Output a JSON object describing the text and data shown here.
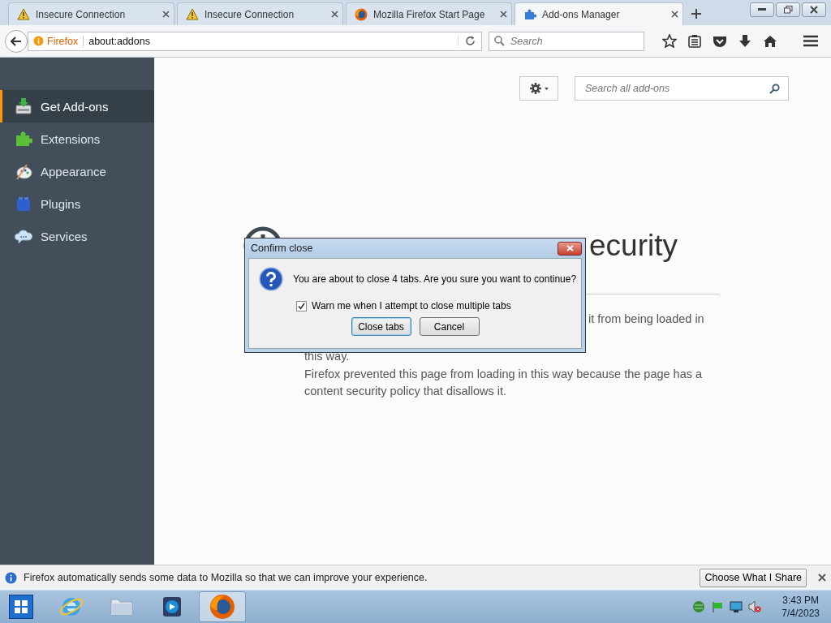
{
  "tabs": [
    {
      "label": "Insecure Connection",
      "kind": "warning",
      "selected": false
    },
    {
      "label": "Insecure Connection",
      "kind": "warning",
      "selected": false
    },
    {
      "label": "Mozilla Firefox Start Page",
      "kind": "firefox",
      "selected": false
    },
    {
      "label": "Add-ons Manager",
      "kind": "puzzle",
      "selected": true
    }
  ],
  "nav": {
    "identity": "Firefox",
    "url": "about:addons",
    "search": {
      "placeholder": "Search"
    }
  },
  "sidebar": {
    "items": [
      {
        "label": "Get Add-ons",
        "kind": "download",
        "selected": true
      },
      {
        "label": "Extensions",
        "kind": "puzzle",
        "selected": false
      },
      {
        "label": "Appearance",
        "kind": "palette",
        "selected": false
      },
      {
        "label": "Plugins",
        "kind": "brick",
        "selected": false
      },
      {
        "label": "Services",
        "kind": "cloud",
        "selected": false
      }
    ]
  },
  "toolbar": {
    "search": {
      "placeholder": "Search all add-ons"
    }
  },
  "page": {
    "heading": "ecurity",
    "fragments": [
      "it from being loaded in",
      "this way."
    ],
    "paragraph": "Firefox prevented this page from loading in this way because the page has a content security policy that disallows it."
  },
  "dialog": {
    "title": "Confirm close",
    "message": "You are about to close 4 tabs. Are you sure you want to continue?",
    "checkbox": {
      "label": "Warn me when I attempt to close multiple tabs",
      "checked": true
    },
    "buttons": [
      {
        "label": "Close tabs",
        "default": true
      },
      {
        "label": "Cancel",
        "default": false
      }
    ]
  },
  "notification": {
    "message": "Firefox automatically sends some data to Mozilla so that we can improve your experience.",
    "button": "Choose What I Share"
  },
  "taskbar": {
    "apps": [
      {
        "kind": "browser",
        "selected": false
      },
      {
        "kind": "folder",
        "selected": false
      },
      {
        "kind": "media",
        "selected": false
      },
      {
        "kind": "firefox",
        "selected": true
      }
    ],
    "clock": {
      "time": "3:43 PM",
      "date": "7/4/2023"
    }
  }
}
